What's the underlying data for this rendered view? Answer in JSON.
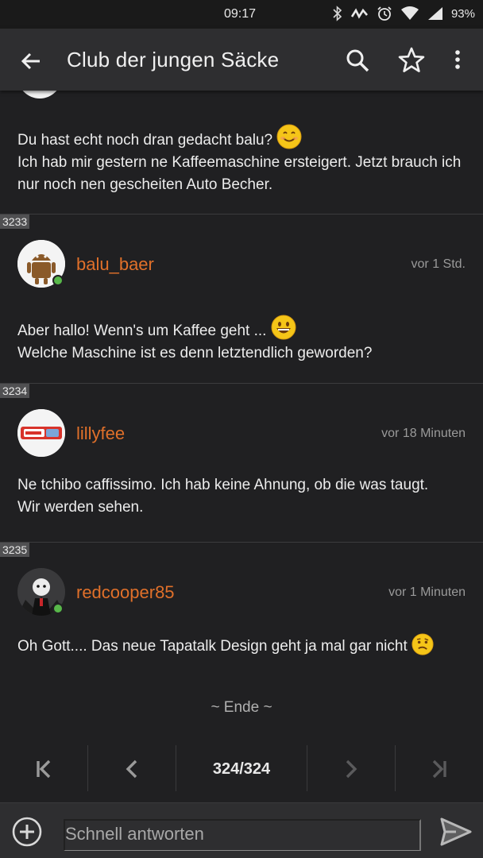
{
  "status_bar": {
    "time": "09:17",
    "icons": [
      "bluetooth-icon",
      "activity-icon",
      "alarm-icon",
      "wifi-icon",
      "signal-icon"
    ],
    "battery": "93%"
  },
  "app_bar": {
    "title": "Club der jungen Säcke",
    "icons": [
      "back-arrow-icon",
      "search-icon",
      "star-icon",
      "more-vert-icon"
    ]
  },
  "posts": [
    {
      "number": "",
      "username": "",
      "time": "",
      "body_lines": [
        "Du hast echt noch dran gedacht balu?",
        "Ich hab mir gestern ne Kaffeemaschine ersteigert. Jetzt brauch ich nur noch nen gescheiten Auto Becher."
      ],
      "emoji": "smiling-face-emoji"
    },
    {
      "number": "3233",
      "username": "balu_baer",
      "time": "vor 1 Std.",
      "online": true,
      "body_lines": [
        "Aber hallo! Wenn's um Kaffee geht ...",
        "Welche Maschine ist es denn letztendlich geworden?"
      ],
      "emoji": "grinning-face-emoji"
    },
    {
      "number": "3234",
      "username": "lillyfee",
      "time": "vor 18 Minuten",
      "online": false,
      "body_lines": [
        "Ne tchibo caffissimo. Ich hab keine Ahnung, ob die was taugt.",
        "Wir werden sehen."
      ]
    },
    {
      "number": "3235",
      "username": "redcooper85",
      "time": "vor 1 Minuten",
      "online": true,
      "body_lines": [
        "Oh Gott.... Das neue Tapatalk Design geht ja mal gar nicht"
      ],
      "emoji": "confused-face-emoji"
    }
  ],
  "end_marker": "~ Ende ~",
  "pager": {
    "current": "324",
    "total": "324",
    "label": "324/324"
  },
  "reply": {
    "placeholder": "Schnell antworten"
  },
  "colors": {
    "background": "#202022",
    "appbar": "#2e2e30",
    "username": "#e0702a",
    "online": "#58b84a"
  }
}
